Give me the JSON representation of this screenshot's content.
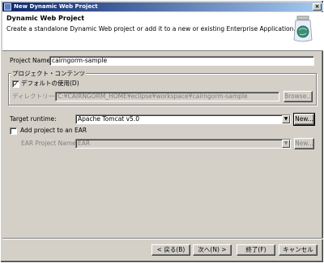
{
  "window": {
    "title": "New Dynamic Web Project",
    "close_glyph": "×"
  },
  "banner": {
    "heading": "Dynamic Web Project",
    "description": "Create a standalone Dynamic Web project or add it to a new or existing Enterprise Application."
  },
  "project_name": {
    "label": "Project Name:",
    "value": "cairngorm-sample"
  },
  "contents": {
    "group_title": "プロジェクト・コンテンツ",
    "use_default_label": "デフォルトの使用(D)",
    "use_default_checked": true,
    "directory_label": "ディレクトリー(Y):",
    "directory_value": "C:¥CAIRNGORM_HOME¥eclipse¥workspace¥cairngorm-sample",
    "browse_label": "Browse..."
  },
  "target_runtime": {
    "label": "Target runtime:",
    "value": "Apache Tomcat v5.0",
    "new_label": "New..."
  },
  "ear": {
    "add_label": "Add project to an EAR",
    "add_checked": false,
    "project_name_label": "EAR Project Name:",
    "project_name_value": "EAR",
    "new_label": "New..."
  },
  "footer": {
    "back_label": "< 戻る(B)",
    "next_label": "次へ(N) >",
    "finish_label": "終了(F)",
    "cancel_label": "キャンセル"
  }
}
